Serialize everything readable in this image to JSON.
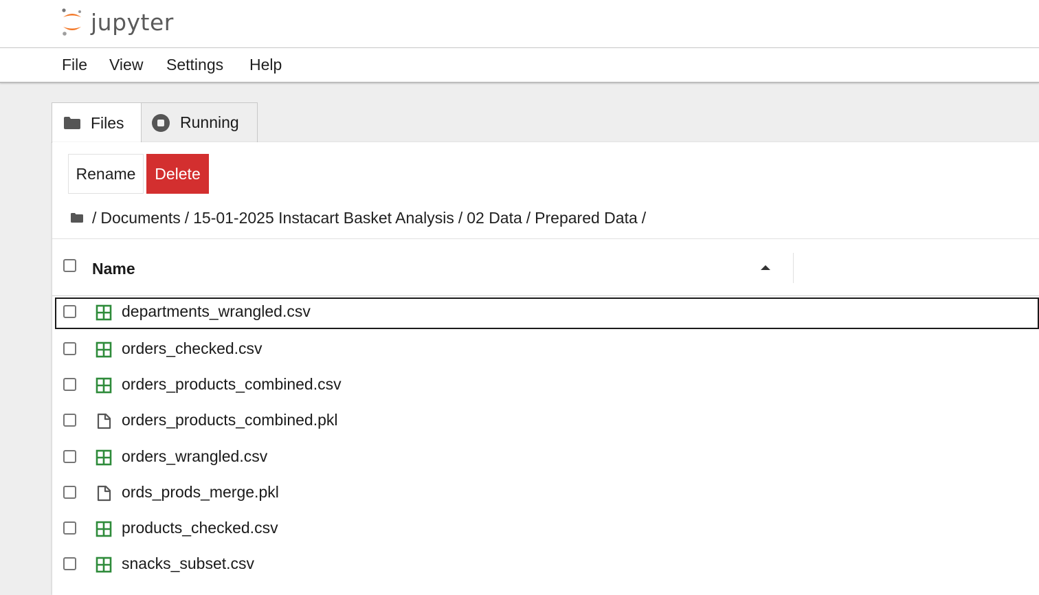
{
  "app": {
    "logo_text": "jupyter",
    "brand_color": "#f37726"
  },
  "menu": {
    "items": [
      "File",
      "View",
      "Settings",
      "Help"
    ]
  },
  "tabs": [
    {
      "label": "Files",
      "icon": "folder-icon",
      "active": true
    },
    {
      "label": "Running",
      "icon": "stop-circle-icon",
      "active": false
    }
  ],
  "toolbar": {
    "rename_label": "Rename",
    "delete_label": "Delete",
    "delete_color": "#d32f2f"
  },
  "breadcrumb": {
    "root_sep": "/",
    "parts": [
      "Documents",
      "15-01-2025 Instacart Basket Analysis",
      "02 Data",
      "Prepared Data"
    ]
  },
  "table": {
    "name_header": "Name",
    "sort_direction": "ascending",
    "rows": [
      {
        "name": "departments_wrangled.csv",
        "type": "csv",
        "icon": "spreadsheet-icon",
        "selected": true
      },
      {
        "name": "orders_checked.csv",
        "type": "csv",
        "icon": "spreadsheet-icon",
        "selected": false
      },
      {
        "name": "orders_products_combined.csv",
        "type": "csv",
        "icon": "spreadsheet-icon",
        "selected": false
      },
      {
        "name": "orders_products_combined.pkl",
        "type": "file",
        "icon": "file-icon",
        "selected": false
      },
      {
        "name": "orders_wrangled.csv",
        "type": "csv",
        "icon": "spreadsheet-icon",
        "selected": false
      },
      {
        "name": "ords_prods_merge.pkl",
        "type": "file",
        "icon": "file-icon",
        "selected": false
      },
      {
        "name": "products_checked.csv",
        "type": "csv",
        "icon": "spreadsheet-icon",
        "selected": false
      },
      {
        "name": "snacks_subset.csv",
        "type": "csv",
        "icon": "spreadsheet-icon",
        "selected": false
      }
    ]
  },
  "colors": {
    "csv_icon": "#2e8b3a",
    "file_icon": "#555555"
  }
}
